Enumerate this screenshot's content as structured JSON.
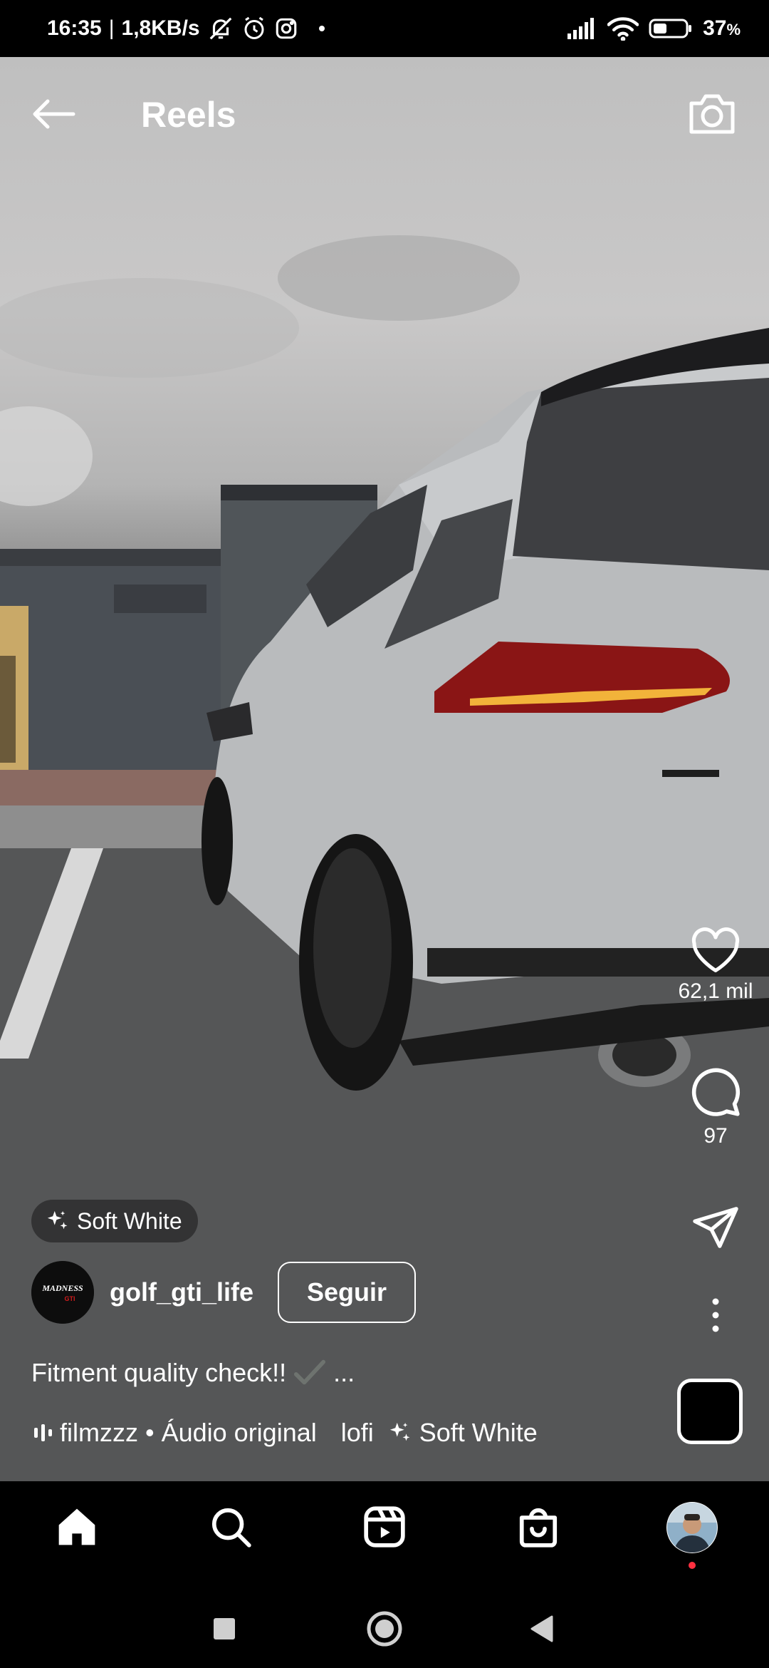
{
  "status_bar": {
    "time": "16:35",
    "speed": "1,8KB/s",
    "battery": "37",
    "battery_unit": "%"
  },
  "header": {
    "title": "Reels"
  },
  "actions": {
    "likes": "62,1 mil",
    "comments": "97"
  },
  "effect": {
    "label": "Soft White"
  },
  "post": {
    "username": "golf_gti_life",
    "follow_label": "Seguir",
    "caption": "Fitment quality check!!",
    "caption_more": "...",
    "avatar_text_1": "MADNESS",
    "avatar_text_2": "GTI"
  },
  "audio": {
    "text": "filmzzz • Áudio original",
    "text2": "lofi",
    "effect": "Soft White"
  },
  "colors": {
    "notification_dot": "#ff3040"
  }
}
